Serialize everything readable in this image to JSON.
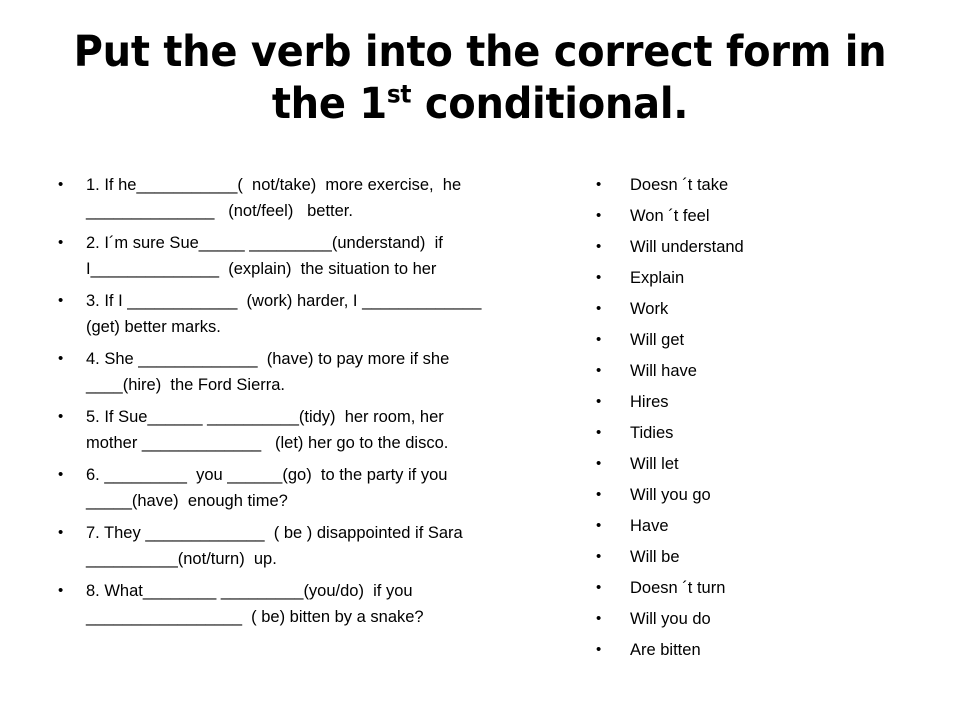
{
  "slide": {
    "title_line1": "Put the verb into the correct form in",
    "title_line2_before": "the 1",
    "title_line2_sup": "st",
    "title_line2_after": " conditional.",
    "bullet_glyph": "•"
  },
  "exercise": {
    "items": [
      "1. If he___________(  not/take)  more exercise,  he\n______________   (not/feel)   better.",
      "2. I´m sure Sue_____ _________(understand)  if\nI______________  (explain)  the situation to her",
      "3. If I ____________  (work) harder, I _____________\n(get) better marks.",
      "4. She _____________  (have) to pay more if she\n____(hire)  the Ford Sierra.",
      "5. If Sue______ __________(tidy)  her room, her\nmother _____________   (let) her go to the disco.",
      "6. _________  you ______(go)  to the party if you\n_____(have)  enough time?",
      "7. They _____________  ( be ) disappointed if Sara\n__________(not/turn)  up.",
      "8. What________ _________(you/do)  if you\n_________________  ( be) bitten by a snake?"
    ]
  },
  "answers": {
    "items": [
      "Doesn ´t take",
      "Won ´t feel",
      "Will understand",
      "Explain",
      "Work",
      "Will get",
      "Will have",
      "Hires",
      "Tidies",
      "Will let",
      "Will you go",
      "Have",
      "Will be",
      "Doesn ´t turn",
      "Will you do",
      "Are bitten"
    ]
  }
}
